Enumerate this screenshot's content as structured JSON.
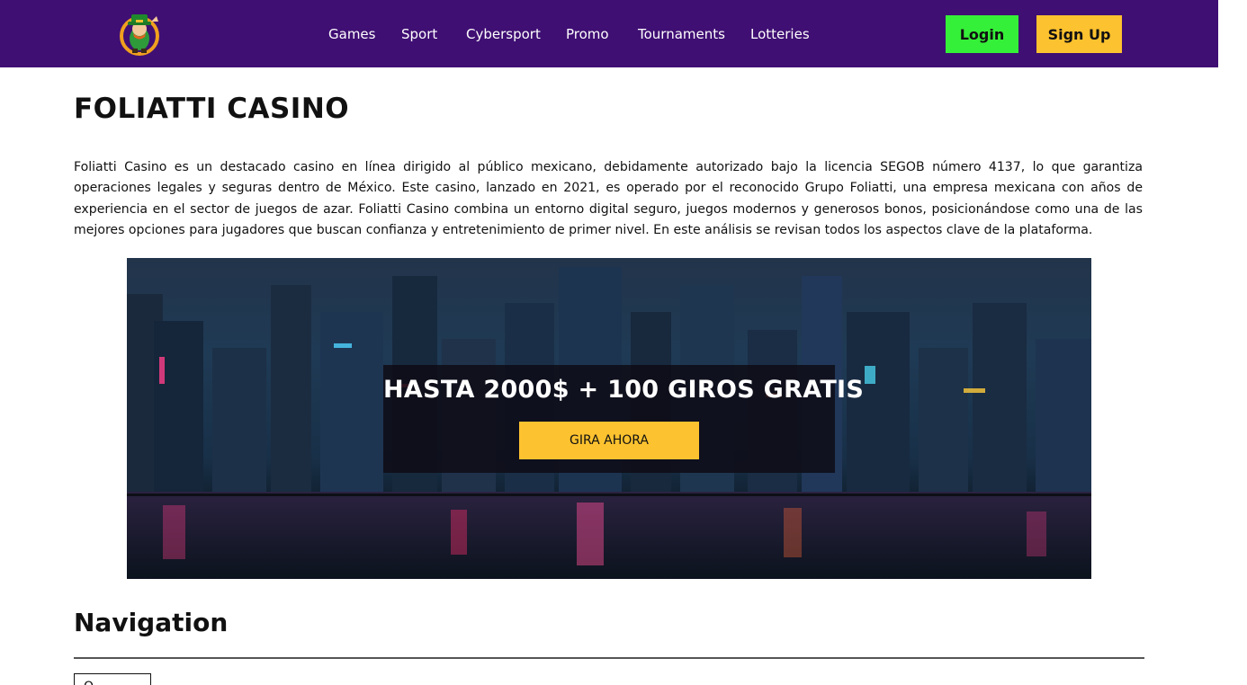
{
  "header": {
    "logo_icon": "leprechaun-mascot-icon",
    "nav": [
      "Games",
      "Sport",
      "Cybersport",
      "Promo",
      "Tournaments",
      "Lotteries"
    ],
    "login_label": "Login",
    "signup_label": "Sign Up"
  },
  "main": {
    "title": "FOLIATTI CASINO",
    "intro": "Foliatti Casino es un destacado casino en línea dirigido al público mexicano, debidamente autorizado bajo la licencia SEGOB número 4137, lo que garantiza operaciones legales y seguras dentro de México. Este casino, lanzado en 2021, es operado por el reconocido Grupo Foliatti, una empresa mexicana con años de experiencia en el sector de juegos de azar. Foliatti Casino combina un entorno digital seguro, juegos modernos y generosos bonos, posicionándose como una de las mejores opciones para jugadores que buscan confianza y entretenimiento de primer nivel. En este análisis se revisan todos los aspectos clave de la plataforma.",
    "banner": {
      "headline": "HASTA 2000$ + 100 GIROS GRATIS",
      "cta_label": "GIRA AHORA"
    },
    "navigation_title": "Navigation",
    "navigation_toggle_label": "O"
  },
  "colors": {
    "header_bg": "#3f0f73",
    "login_bg": "#35f038",
    "accent_yellow": "#fdc22f"
  }
}
